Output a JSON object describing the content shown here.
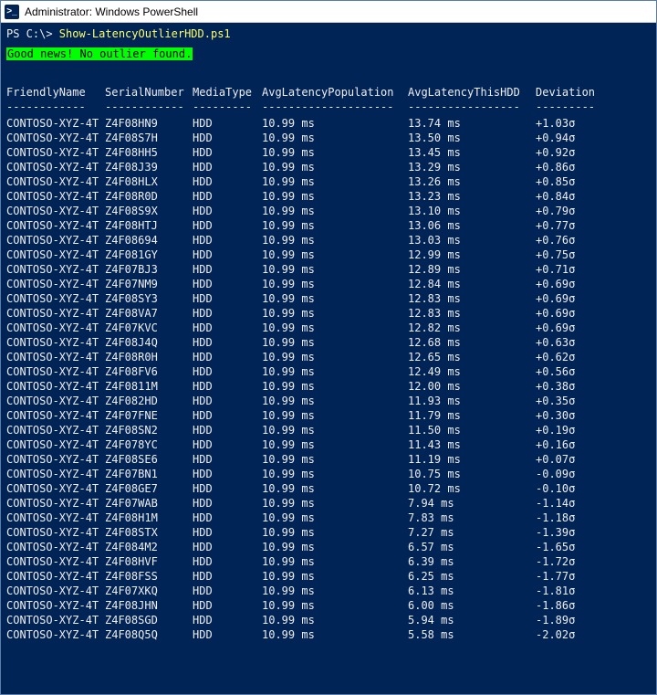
{
  "title": "Administrator: Windows PowerShell",
  "prompt": {
    "path": "PS C:\\> ",
    "command": "Show-LatencyOutlierHDD.ps1"
  },
  "status": "Good news! No outlier found.",
  "headers": {
    "friendly": "FriendlyName",
    "serial": "SerialNumber",
    "media": "MediaType",
    "avgpop": "AvgLatencyPopulation",
    "avgthis": "AvgLatencyThisHDD",
    "dev": "Deviation"
  },
  "dividers": {
    "friendly": "------------",
    "serial": "------------",
    "media": "---------",
    "avgpop": "--------------------",
    "avgthis": "-----------------",
    "dev": "---------"
  },
  "rows": [
    {
      "friendly": "CONTOSO-XYZ-4T",
      "serial": "Z4F08HN9",
      "media": "HDD",
      "avgpop": "10.99 ms",
      "avgthis": "13.74 ms",
      "dev": "+1.03σ"
    },
    {
      "friendly": "CONTOSO-XYZ-4T",
      "serial": "Z4F08S7H",
      "media": "HDD",
      "avgpop": "10.99 ms",
      "avgthis": "13.50 ms",
      "dev": "+0.94σ"
    },
    {
      "friendly": "CONTOSO-XYZ-4T",
      "serial": "Z4F08HH5",
      "media": "HDD",
      "avgpop": "10.99 ms",
      "avgthis": "13.45 ms",
      "dev": "+0.92σ"
    },
    {
      "friendly": "CONTOSO-XYZ-4T",
      "serial": "Z4F08J39",
      "media": "HDD",
      "avgpop": "10.99 ms",
      "avgthis": "13.29 ms",
      "dev": "+0.86σ"
    },
    {
      "friendly": "CONTOSO-XYZ-4T",
      "serial": "Z4F08HLX",
      "media": "HDD",
      "avgpop": "10.99 ms",
      "avgthis": "13.26 ms",
      "dev": "+0.85σ"
    },
    {
      "friendly": "CONTOSO-XYZ-4T",
      "serial": "Z4F08R0D",
      "media": "HDD",
      "avgpop": "10.99 ms",
      "avgthis": "13.23 ms",
      "dev": "+0.84σ"
    },
    {
      "friendly": "CONTOSO-XYZ-4T",
      "serial": "Z4F08S9X",
      "media": "HDD",
      "avgpop": "10.99 ms",
      "avgthis": "13.10 ms",
      "dev": "+0.79σ"
    },
    {
      "friendly": "CONTOSO-XYZ-4T",
      "serial": "Z4F08HTJ",
      "media": "HDD",
      "avgpop": "10.99 ms",
      "avgthis": "13.06 ms",
      "dev": "+0.77σ"
    },
    {
      "friendly": "CONTOSO-XYZ-4T",
      "serial": "Z4F08694",
      "media": "HDD",
      "avgpop": "10.99 ms",
      "avgthis": "13.03 ms",
      "dev": "+0.76σ"
    },
    {
      "friendly": "CONTOSO-XYZ-4T",
      "serial": "Z4F081GY",
      "media": "HDD",
      "avgpop": "10.99 ms",
      "avgthis": "12.99 ms",
      "dev": "+0.75σ"
    },
    {
      "friendly": "CONTOSO-XYZ-4T",
      "serial": "Z4F07BJ3",
      "media": "HDD",
      "avgpop": "10.99 ms",
      "avgthis": "12.89 ms",
      "dev": "+0.71σ"
    },
    {
      "friendly": "CONTOSO-XYZ-4T",
      "serial": "Z4F07NM9",
      "media": "HDD",
      "avgpop": "10.99 ms",
      "avgthis": "12.84 ms",
      "dev": "+0.69σ"
    },
    {
      "friendly": "CONTOSO-XYZ-4T",
      "serial": "Z4F08SY3",
      "media": "HDD",
      "avgpop": "10.99 ms",
      "avgthis": "12.83 ms",
      "dev": "+0.69σ"
    },
    {
      "friendly": "CONTOSO-XYZ-4T",
      "serial": "Z4F08VA7",
      "media": "HDD",
      "avgpop": "10.99 ms",
      "avgthis": "12.83 ms",
      "dev": "+0.69σ"
    },
    {
      "friendly": "CONTOSO-XYZ-4T",
      "serial": "Z4F07KVC",
      "media": "HDD",
      "avgpop": "10.99 ms",
      "avgthis": "12.82 ms",
      "dev": "+0.69σ"
    },
    {
      "friendly": "CONTOSO-XYZ-4T",
      "serial": "Z4F08J4Q",
      "media": "HDD",
      "avgpop": "10.99 ms",
      "avgthis": "12.68 ms",
      "dev": "+0.63σ"
    },
    {
      "friendly": "CONTOSO-XYZ-4T",
      "serial": "Z4F08R0H",
      "media": "HDD",
      "avgpop": "10.99 ms",
      "avgthis": "12.65 ms",
      "dev": "+0.62σ"
    },
    {
      "friendly": "CONTOSO-XYZ-4T",
      "serial": "Z4F08FV6",
      "media": "HDD",
      "avgpop": "10.99 ms",
      "avgthis": "12.49 ms",
      "dev": "+0.56σ"
    },
    {
      "friendly": "CONTOSO-XYZ-4T",
      "serial": "Z4F0811M",
      "media": "HDD",
      "avgpop": "10.99 ms",
      "avgthis": "12.00 ms",
      "dev": "+0.38σ"
    },
    {
      "friendly": "CONTOSO-XYZ-4T",
      "serial": "Z4F082HD",
      "media": "HDD",
      "avgpop": "10.99 ms",
      "avgthis": "11.93 ms",
      "dev": "+0.35σ"
    },
    {
      "friendly": "CONTOSO-XYZ-4T",
      "serial": "Z4F07FNE",
      "media": "HDD",
      "avgpop": "10.99 ms",
      "avgthis": "11.79 ms",
      "dev": "+0.30σ"
    },
    {
      "friendly": "CONTOSO-XYZ-4T",
      "serial": "Z4F08SN2",
      "media": "HDD",
      "avgpop": "10.99 ms",
      "avgthis": "11.50 ms",
      "dev": "+0.19σ"
    },
    {
      "friendly": "CONTOSO-XYZ-4T",
      "serial": "Z4F078YC",
      "media": "HDD",
      "avgpop": "10.99 ms",
      "avgthis": "11.43 ms",
      "dev": "+0.16σ"
    },
    {
      "friendly": "CONTOSO-XYZ-4T",
      "serial": "Z4F08SE6",
      "media": "HDD",
      "avgpop": "10.99 ms",
      "avgthis": "11.19 ms",
      "dev": "+0.07σ"
    },
    {
      "friendly": "CONTOSO-XYZ-4T",
      "serial": "Z4F07BN1",
      "media": "HDD",
      "avgpop": "10.99 ms",
      "avgthis": "10.75 ms",
      "dev": "-0.09σ"
    },
    {
      "friendly": "CONTOSO-XYZ-4T",
      "serial": "Z4F08GE7",
      "media": "HDD",
      "avgpop": "10.99 ms",
      "avgthis": "10.72 ms",
      "dev": "-0.10σ"
    },
    {
      "friendly": "CONTOSO-XYZ-4T",
      "serial": "Z4F07WAB",
      "media": "HDD",
      "avgpop": "10.99 ms",
      "avgthis": " 7.94 ms",
      "dev": "-1.14σ"
    },
    {
      "friendly": "CONTOSO-XYZ-4T",
      "serial": "Z4F08H1M",
      "media": "HDD",
      "avgpop": "10.99 ms",
      "avgthis": " 7.83 ms",
      "dev": "-1.18σ"
    },
    {
      "friendly": "CONTOSO-XYZ-4T",
      "serial": "Z4F08STX",
      "media": "HDD",
      "avgpop": "10.99 ms",
      "avgthis": " 7.27 ms",
      "dev": "-1.39σ"
    },
    {
      "friendly": "CONTOSO-XYZ-4T",
      "serial": "Z4F084M2",
      "media": "HDD",
      "avgpop": "10.99 ms",
      "avgthis": " 6.57 ms",
      "dev": "-1.65σ"
    },
    {
      "friendly": "CONTOSO-XYZ-4T",
      "serial": "Z4F08HVF",
      "media": "HDD",
      "avgpop": "10.99 ms",
      "avgthis": " 6.39 ms",
      "dev": "-1.72σ"
    },
    {
      "friendly": "CONTOSO-XYZ-4T",
      "serial": "Z4F08FSS",
      "media": "HDD",
      "avgpop": "10.99 ms",
      "avgthis": " 6.25 ms",
      "dev": "-1.77σ"
    },
    {
      "friendly": "CONTOSO-XYZ-4T",
      "serial": "Z4F07XKQ",
      "media": "HDD",
      "avgpop": "10.99 ms",
      "avgthis": " 6.13 ms",
      "dev": "-1.81σ"
    },
    {
      "friendly": "CONTOSO-XYZ-4T",
      "serial": "Z4F08JHN",
      "media": "HDD",
      "avgpop": "10.99 ms",
      "avgthis": " 6.00 ms",
      "dev": "-1.86σ"
    },
    {
      "friendly": "CONTOSO-XYZ-4T",
      "serial": "Z4F08SGD",
      "media": "HDD",
      "avgpop": "10.99 ms",
      "avgthis": " 5.94 ms",
      "dev": "-1.89σ"
    },
    {
      "friendly": "CONTOSO-XYZ-4T",
      "serial": "Z4F08Q5Q",
      "media": "HDD",
      "avgpop": "10.99 ms",
      "avgthis": " 5.58 ms",
      "dev": "-2.02σ"
    }
  ]
}
